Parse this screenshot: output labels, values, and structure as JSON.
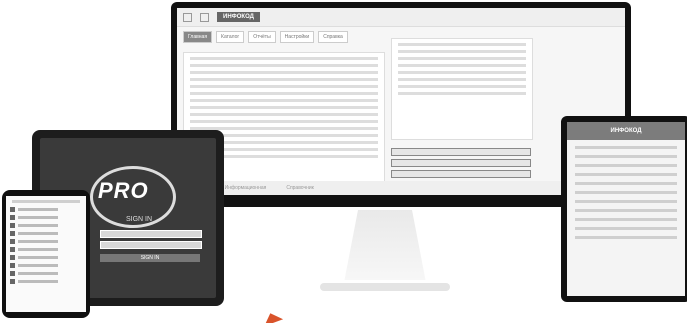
{
  "monitor": {
    "brand": "ИНФОКОД",
    "footer": [
      "◄ ◄ ►",
      "Информационная",
      "Справочник"
    ],
    "tabs": [
      "Главная",
      "Каталог",
      "Отчёты",
      "Настройки",
      "Справка"
    ]
  },
  "tablet": {
    "logo": "PRO",
    "sign_in": "SIGN IN",
    "login_button": "SIGN IN"
  },
  "laptop": {
    "brand": "ИНФОКОД"
  },
  "colors": {
    "accent": "#d9542b",
    "dark_bezel": "#111111"
  }
}
